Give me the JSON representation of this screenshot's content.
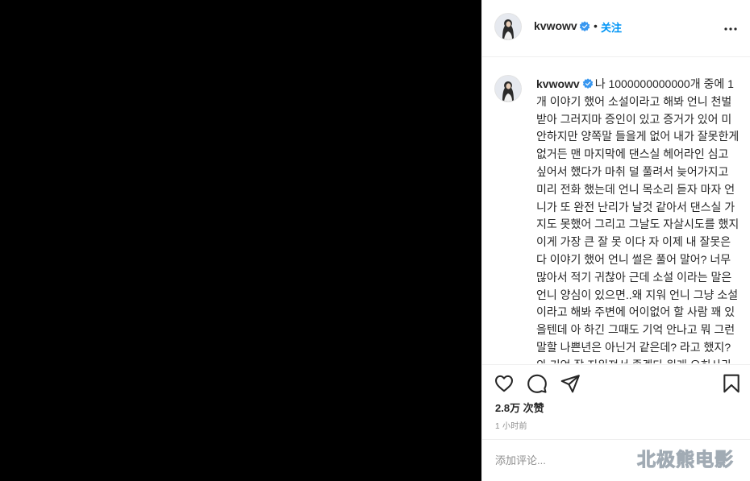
{
  "post": {
    "author": {
      "username": "kvwowv",
      "verified": true,
      "avatar_icon": "profile-photo"
    },
    "header": {
      "separator": "•",
      "follow_label": "关注",
      "more_icon": "more-options-icon"
    },
    "caption": {
      "username": "kvwowv",
      "text": "나 1000000000000개 중에 1개 이야기 했어 소설이라고 해봐 언니 천벌 받아 그러지마 증인이 있고 증거가 있어 미안하지만 양쪽말 들을게 없어 내가 잘못한게 없거든 맨 마지막에 댄스실 헤어라인 심고 싶어서 했다가 마취 덜 풀려서 늦어가지고 미리 전화 했는데 언니 목소리 듣자 마자 언니가 또 완전 난리가 날것 같아서 댄스실 가지도 못했어 그리고 그날도 자살시도를 했지 이게 가장 큰 잘 못 이다 자 이제 내 잘못은 다 이야기 했어 언니 썰은 풀어 말어? 너무 많아서 적기 귀찮아 근데 소설 이라는 말은 언니 양심이 있으면..왜 지워 언니 그냥 소설이라고 해봐 주변에 어이없어 할 사람 꽤 있을텐데 아 하긴 그때도 기억 안나고 뭐 그런 말할 나쁜년은 아닌거 같은데? 라고 했지? 와 기억 잘 지워져서 좋겠다 원래 오히사라요 잘 기어모하다더라 내 기"
    },
    "actions": {
      "like_icon": "heart-icon",
      "comment_icon": "comment-bubble-icon",
      "share_icon": "paper-plane-icon",
      "save_icon": "bookmark-icon"
    },
    "likes": "2.8万 次赞",
    "timestamp": "1 小时前",
    "comment": {
      "placeholder": "添加评论...",
      "value": ""
    },
    "colors": {
      "follow": "#0095f6",
      "verified_badge": "#3897f0",
      "text": "#262626",
      "muted": "#8e8e8e",
      "border": "#efefef",
      "media_background": "#000000"
    }
  },
  "watermark": "北极熊电影"
}
